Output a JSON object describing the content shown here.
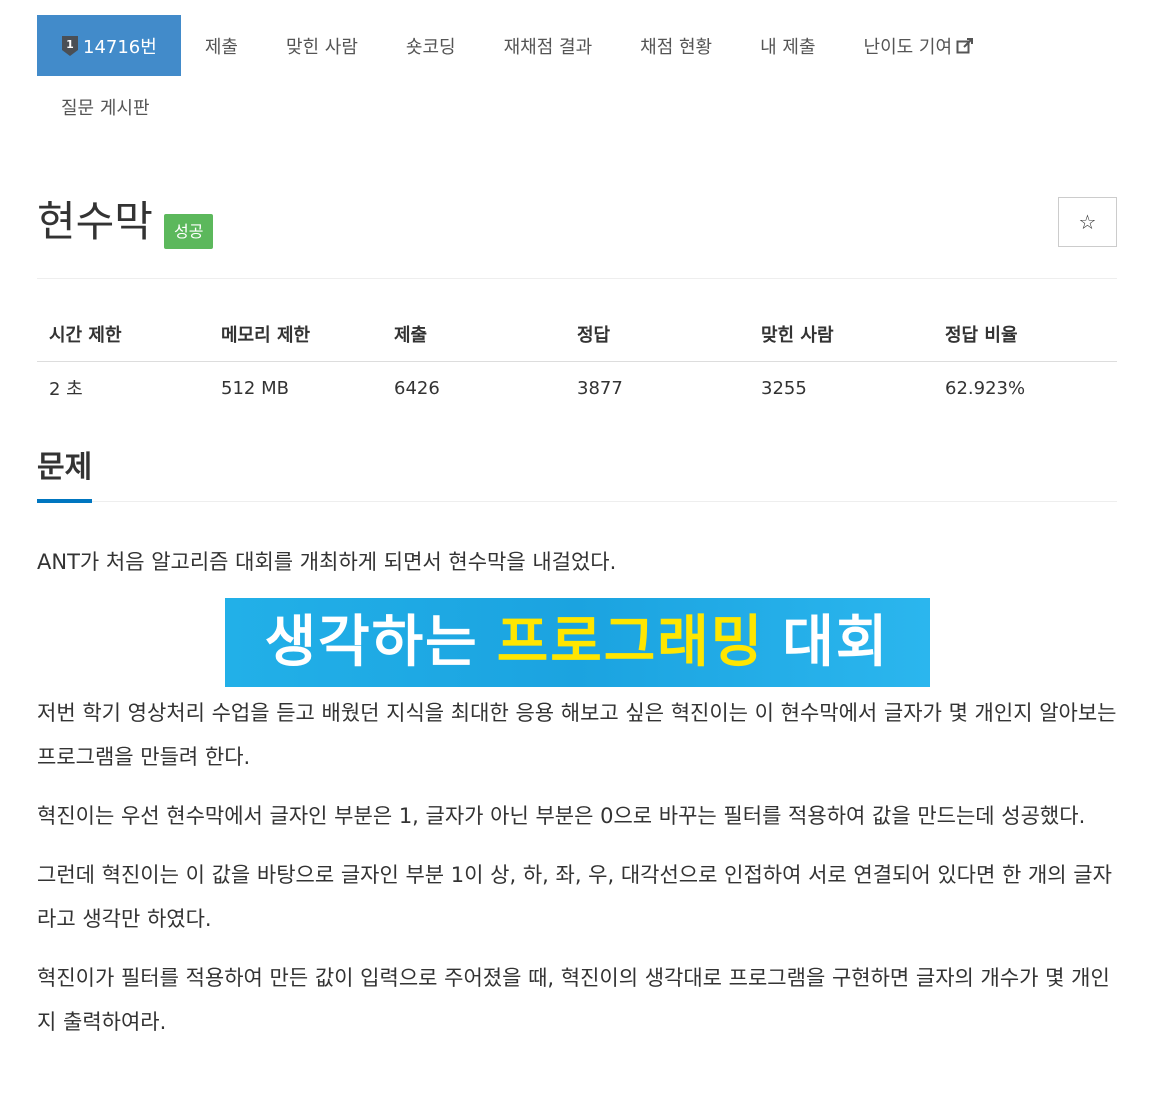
{
  "nav": {
    "problem_id": "14716번",
    "badge_number": "1",
    "items": [
      "제출",
      "맞힌 사람",
      "숏코딩",
      "재채점 결과",
      "채점 현황",
      "내 제출",
      "난이도 기여"
    ],
    "row2": [
      "질문 게시판"
    ]
  },
  "title": "현수막",
  "status": "성공",
  "star": "☆",
  "table": {
    "headers": [
      "시간 제한",
      "메모리 제한",
      "제출",
      "정답",
      "맞힌 사람",
      "정답 비율"
    ],
    "values": [
      "2 초",
      "512 MB",
      "6426",
      "3877",
      "3255",
      "62.923%"
    ]
  },
  "section_title": "문제",
  "paragraphs": [
    "ANT가 처음 알고리즘 대회를 개최하게 되면서 현수막을 내걸었다.",
    "저번 학기 영상처리 수업을 듣고 배웠던 지식을 최대한 응용 해보고 싶은 혁진이는 이 현수막에서 글자가 몇 개인지 알아보는 프로그램을 만들려 한다.",
    "혁진이는 우선 현수막에서 글자인 부분은 1, 글자가 아닌 부분은 0으로 바꾸는 필터를 적용하여 값을 만드는데 성공했다.",
    "그런데 혁진이는 이 값을 바탕으로 글자인 부분 1이 상, 하, 좌, 우, 대각선으로 인접하여 서로 연결되어 있다면 한 개의 글자라고 생각만 하였다.",
    "혁진이가 필터를 적용하여 만든 값이 입력으로 주어졌을 때, 혁진이의 생각대로 프로그램을 구현하면 글자의 개수가 몇 개인지 출력하여라."
  ],
  "banner": {
    "part1": "생각하는",
    "part2": "프로그래밍",
    "part3": "대회"
  },
  "colors": {
    "nav_active": "#428bca",
    "status_badge": "#5cb85c",
    "section_underline": "#0076c0",
    "banner_bg": "#1ba3e0",
    "banner_highlight": "#ffe600"
  }
}
